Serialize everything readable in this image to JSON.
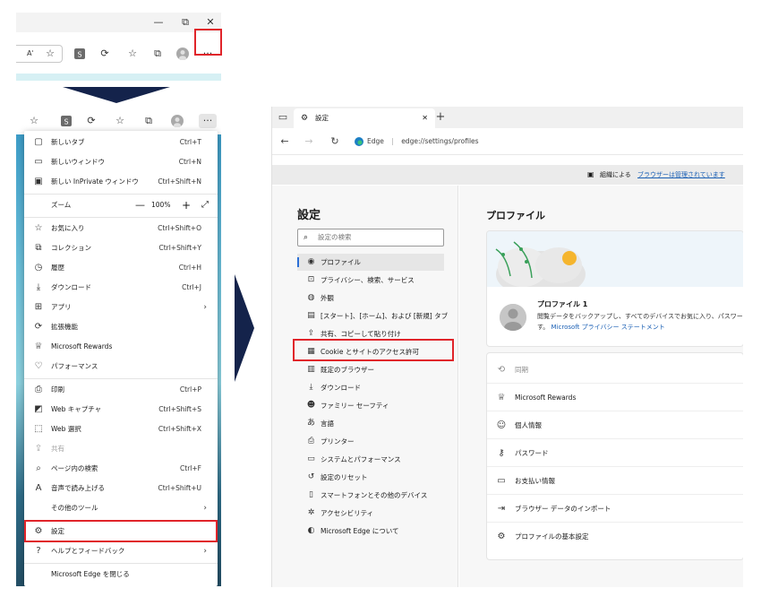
{
  "top_strip": {
    "window_controls": {
      "minimize": "—",
      "maximize": "⧉",
      "close": "✕"
    },
    "read_aloud_icon": "Aʾ",
    "more_button_label": "···"
  },
  "menu_toolbar": {
    "more_button_label": "···"
  },
  "menu": {
    "items": [
      {
        "label": "新しいタブ",
        "shortcut": "Ctrl+T",
        "icon": "tab-icon"
      },
      {
        "label": "新しいウィンドウ",
        "shortcut": "Ctrl+N",
        "icon": "window-icon"
      },
      {
        "label": "新しい InPrivate ウィンドウ",
        "shortcut": "Ctrl+Shift+N",
        "icon": "inprivate-icon"
      },
      {
        "label": "お気に入り",
        "shortcut": "Ctrl+Shift+O",
        "icon": "favorites-icon"
      },
      {
        "label": "コレクション",
        "shortcut": "Ctrl+Shift+Y",
        "icon": "collections-icon"
      },
      {
        "label": "履歴",
        "shortcut": "Ctrl+H",
        "icon": "history-icon"
      },
      {
        "label": "ダウンロード",
        "shortcut": "Ctrl+J",
        "icon": "download-icon"
      },
      {
        "label": "アプリ",
        "shortcut": "",
        "icon": "apps-icon"
      },
      {
        "label": "拡張機能",
        "shortcut": "",
        "icon": "extensions-icon"
      },
      {
        "label": "Microsoft Rewards",
        "shortcut": "",
        "icon": "rewards-icon"
      },
      {
        "label": "パフォーマンス",
        "shortcut": "",
        "icon": "performance-icon"
      },
      {
        "label": "印刷",
        "shortcut": "Ctrl+P",
        "icon": "print-icon"
      },
      {
        "label": "Web キャプチャ",
        "shortcut": "Ctrl+Shift+S",
        "icon": "web-capture-icon"
      },
      {
        "label": "Web 選択",
        "shortcut": "Ctrl+Shift+X",
        "icon": "web-select-icon"
      },
      {
        "label": "共有",
        "shortcut": "",
        "icon": "share-icon"
      },
      {
        "label": "ページ内の検索",
        "shortcut": "Ctrl+F",
        "icon": "find-icon"
      },
      {
        "label": "音声で読み上げる",
        "shortcut": "Ctrl+Shift+U",
        "icon": "read-aloud-icon"
      },
      {
        "label": "その他のツール",
        "shortcut": "",
        "icon": ""
      },
      {
        "label": "設定",
        "shortcut": "",
        "icon": "gear-icon"
      },
      {
        "label": "ヘルプとフィードバック",
        "shortcut": "",
        "icon": "help-icon"
      },
      {
        "label": "Microsoft Edge を閉じる",
        "shortcut": "",
        "icon": ""
      }
    ],
    "zoom": {
      "label": "ズーム",
      "minus": "—",
      "value": "100%",
      "plus": "+",
      "fullscreen": "⤢"
    }
  },
  "settings_window": {
    "tab_title": "設定",
    "tab_close": "✕",
    "new_tab": "+",
    "url_site_label": "Edge",
    "url_separator": "|",
    "url": "edge://settings/profiles",
    "managed_notice_prefix": "組織による",
    "managed_notice_link": "ブラウザーは管理されています",
    "sidebar": {
      "title": "設定",
      "search_placeholder": "設定の検索",
      "items": [
        {
          "label": "プロファイル",
          "icon": "profile-icon"
        },
        {
          "label": "プライバシー、検索、サービス",
          "icon": "lock-icon"
        },
        {
          "label": "外観",
          "icon": "appearance-icon"
        },
        {
          "label": "[スタート]、[ホーム]、および [新規] タブ",
          "icon": "home-tab-icon"
        },
        {
          "label": "共有、コピーして貼り付け",
          "icon": "share-copy-icon"
        },
        {
          "label": "Cookie とサイトのアクセス許可",
          "icon": "cookie-icon"
        },
        {
          "label": "既定のブラウザー",
          "icon": "default-browser-icon"
        },
        {
          "label": "ダウンロード",
          "icon": "download-icon"
        },
        {
          "label": "ファミリー セーフティ",
          "icon": "family-icon"
        },
        {
          "label": "言語",
          "icon": "language-icon"
        },
        {
          "label": "プリンター",
          "icon": "printer-icon"
        },
        {
          "label": "システムとパフォーマンス",
          "icon": "system-icon"
        },
        {
          "label": "設定のリセット",
          "icon": "reset-icon"
        },
        {
          "label": "スマートフォンとその他のデバイス",
          "icon": "phone-icon"
        },
        {
          "label": "アクセシビリティ",
          "icon": "accessibility-icon"
        },
        {
          "label": "Microsoft Edge について",
          "icon": "edge-icon"
        }
      ]
    },
    "main": {
      "title": "プロファイル",
      "profile_name": "プロファイル 1",
      "profile_desc": "閲覧データをバックアップし、すべてのデバイスでお気に入り、パスワード",
      "profile_desc_line2": "す。",
      "privacy_link": "Microsoft プライバシー ステートメント",
      "rows": [
        {
          "label": "同期",
          "icon": "sync-icon",
          "disabled": true
        },
        {
          "label": "Microsoft Rewards",
          "icon": "rewards-icon",
          "disabled": false
        },
        {
          "label": "個人情報",
          "icon": "personal-info-icon",
          "disabled": false
        },
        {
          "label": "パスワード",
          "icon": "key-icon",
          "disabled": false
        },
        {
          "label": "お支払い情報",
          "icon": "card-icon",
          "disabled": false
        },
        {
          "label": "ブラウザー データのインポート",
          "icon": "import-icon",
          "disabled": false
        },
        {
          "label": "プロファイルの基本設定",
          "icon": "profile-settings-icon",
          "disabled": false
        }
      ]
    }
  },
  "colors": {
    "highlight": "#e0242a",
    "arrow": "#14234b",
    "link": "#1a5fb4"
  }
}
